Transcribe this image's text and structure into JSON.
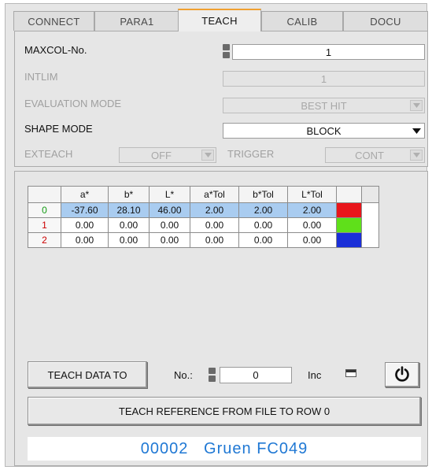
{
  "tabs": [
    "CONNECT",
    "PARA1",
    "TEACH",
    "CALIB",
    "DOCU"
  ],
  "active_tab": "TEACH",
  "settings": {
    "maxcol_label": "MAXCOL-No.",
    "maxcol_value": "1",
    "intlim_label": "INTLIM",
    "intlim_value": "1",
    "eval_label": "EVALUATION MODE",
    "eval_value": "BEST HIT",
    "shape_label": "SHAPE MODE",
    "shape_value": "BLOCK",
    "exteach_label": "EXTEACH",
    "exteach_value": "OFF",
    "trigger_label": "TRIGGER",
    "trigger_value": "CONT"
  },
  "table": {
    "headers": [
      "a*",
      "b*",
      "L*",
      "a*Tol",
      "b*Tol",
      "L*Tol"
    ],
    "rows": [
      {
        "idx": "0",
        "values": [
          "-37.60",
          "28.10",
          "46.00",
          "2.00",
          "2.00",
          "2.00"
        ],
        "swatch": "#e8151b"
      },
      {
        "idx": "1",
        "values": [
          "0.00",
          "0.00",
          "0.00",
          "0.00",
          "0.00",
          "0.00"
        ],
        "swatch": "#5fe01a"
      },
      {
        "idx": "2",
        "values": [
          "0.00",
          "0.00",
          "0.00",
          "0.00",
          "0.00",
          "0.00"
        ],
        "swatch": "#1a2fd8"
      }
    ]
  },
  "controls": {
    "teach_data_to_label": "TEACH DATA TO",
    "no_label": "No.:",
    "no_value": "0",
    "inc_label": "Inc",
    "teach_ref_label": "TEACH REFERENCE FROM FILE TO ROW 0"
  },
  "status": {
    "text": "00002   Gruen FC049"
  },
  "colors": {
    "accent_tab": "#f0a030",
    "selection": "#a9ccf0",
    "status_text": "#1f78d4"
  }
}
